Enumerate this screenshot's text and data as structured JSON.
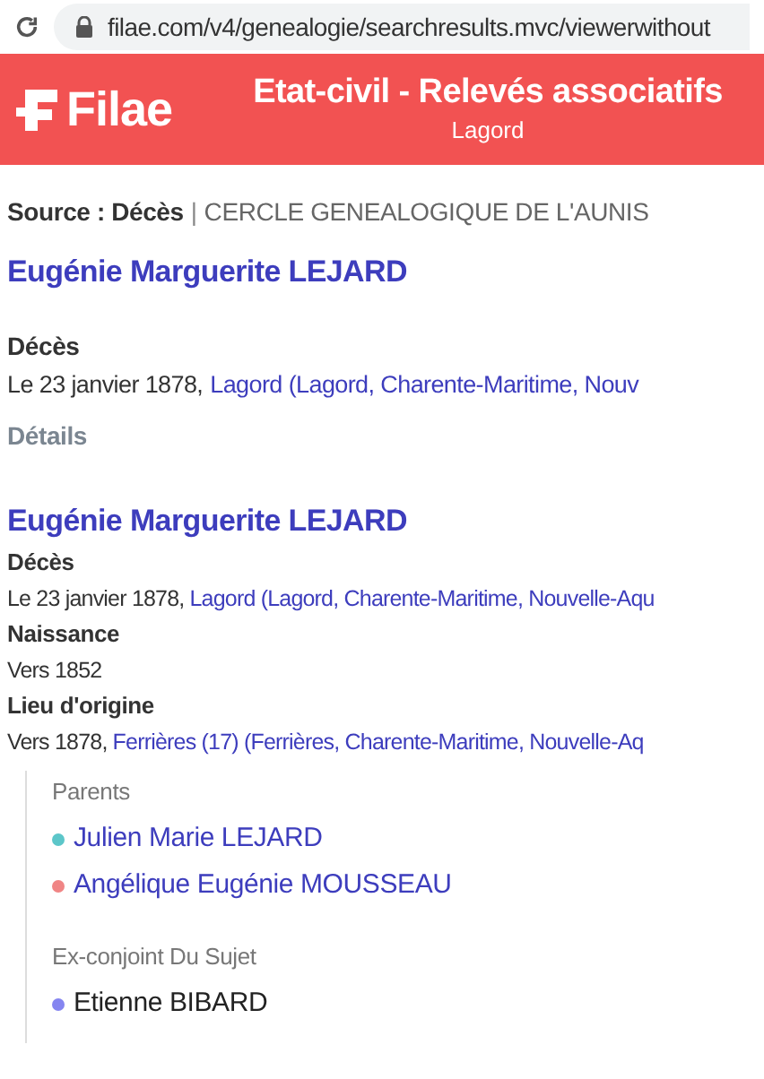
{
  "browser": {
    "url": "filae.com/v4/genealogie/searchresults.mvc/viewerwithout"
  },
  "header": {
    "logo": "Filae",
    "title": "Etat-civil - Relevés associatifs",
    "subtitle": "Lagord"
  },
  "source": {
    "label": "Source : Décès",
    "separator": "|",
    "org": "CERCLE GENEALOGIQUE DE L'AUNIS"
  },
  "summary": {
    "name": "Eugénie Marguerite LEJARD",
    "event": "Décès",
    "date": "Le 23 janvier 1878,",
    "place": "Lagord (Lagord, Charente-Maritime, Nouv",
    "details": "Détails"
  },
  "record": {
    "name": "Eugénie Marguerite LEJARD",
    "facts": [
      {
        "label": "Décès",
        "date": "Le 23 janvier 1878,",
        "place": "Lagord (Lagord, Charente-Maritime, Nouvelle-Aqu"
      },
      {
        "label": "Naissance",
        "date": "Vers 1852"
      },
      {
        "label": "Lieu d'origine",
        "date": "Vers 1878,",
        "place": "Ferrières (17) (Ferrières, Charente-Maritime, Nouvelle-Aq"
      }
    ],
    "relations": [
      {
        "heading": "Parents",
        "people": [
          {
            "name": "Julien Marie LEJARD",
            "color": "#5cc6c9",
            "link": true
          },
          {
            "name": "Angélique Eugénie MOUSSEAU",
            "color": "#f08585",
            "link": true
          }
        ]
      },
      {
        "heading": "Ex-conjoint Du Sujet",
        "people": [
          {
            "name": "Etienne BIBARD",
            "color": "#8585f0",
            "link": false
          }
        ]
      }
    ]
  }
}
